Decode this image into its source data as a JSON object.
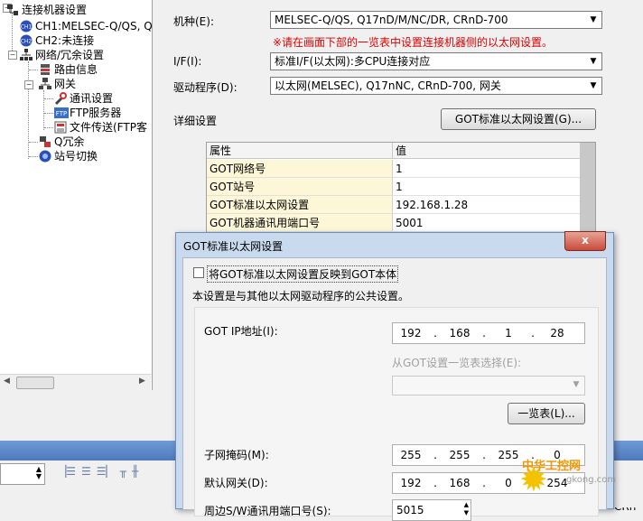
{
  "tree": {
    "items": [
      {
        "label": "连接机器设置",
        "icon": "network-icon"
      },
      {
        "label": "CH1:MELSEC-Q/QS, Q",
        "icon": "channel-icon"
      },
      {
        "label": "CH2:未连接",
        "icon": "channel-icon"
      },
      {
        "label": "网络/冗余设置",
        "icon": "network-icon"
      },
      {
        "label": "路由信息",
        "icon": "routing-icon"
      },
      {
        "label": "网关",
        "icon": "gateway-icon"
      },
      {
        "label": "通讯设置",
        "icon": "communication-icon"
      },
      {
        "label": "FTP服务器",
        "icon": "ftp-icon"
      },
      {
        "label": "文件传送(FTP客",
        "icon": "file-transfer-icon"
      },
      {
        "label": "Q冗余",
        "icon": "redundancy-icon"
      },
      {
        "label": "站号切换",
        "icon": "station-switch-icon"
      }
    ],
    "ch_badge_1": "CH1",
    "ch_badge_2": "CH2",
    "ftp_badge": "FTP"
  },
  "settings": {
    "model_label": "机种(E):",
    "model_value": "MELSEC-Q/QS, Q17nD/M/NC/DR, CRnD-700",
    "warning": "※请在画面下部的一览表中设置连接机器侧的以太网设置。",
    "if_label": "I/F(I):",
    "if_value": "标准I/F(以太网):多CPU连接对应",
    "driver_label": "驱动程序(D):",
    "driver_value": "以太网(MELSEC), Q17nNC, CRnD-700, 网关",
    "detail_label": "详细设置",
    "got_eth_button": "GOT标准以太网设置(G)..."
  },
  "grid": {
    "headers": [
      "属性",
      "值"
    ],
    "rows": [
      [
        "GOT网络号",
        "1"
      ],
      [
        "GOT站号",
        "1"
      ],
      [
        "GOT标准以太网设置",
        "192.168.1.28"
      ],
      [
        "GOT机器通讯用端口号",
        "5001"
      ]
    ]
  },
  "dialog": {
    "title": "GOT标准以太网设置",
    "close": "x",
    "reflect_checkbox": "将GOT标准以太网设置反映到GOT本体",
    "note": "本设置是与其他以太网驱动程序的公共设置。",
    "ip_label": "GOT IP地址(I):",
    "ip": [
      "192",
      "168",
      "1",
      "28"
    ],
    "select_label": "从GOT设置一览表选择(E):",
    "select_value": "",
    "list_button": "一览表(L)...",
    "subnet_label": "子网掩码(M):",
    "subnet": [
      "255",
      "255",
      "255",
      "0"
    ],
    "gateway_label": "默认网关(D):",
    "gateway": [
      "192",
      "168",
      "0",
      "254"
    ],
    "port_label": "周边S/W通讯用端口号(S):",
    "port_value": "5015"
  },
  "background_text": {
    "right_edge": "R, CRn"
  },
  "watermark": {
    "brand": "中华工控网",
    "site": "gkong.com"
  }
}
